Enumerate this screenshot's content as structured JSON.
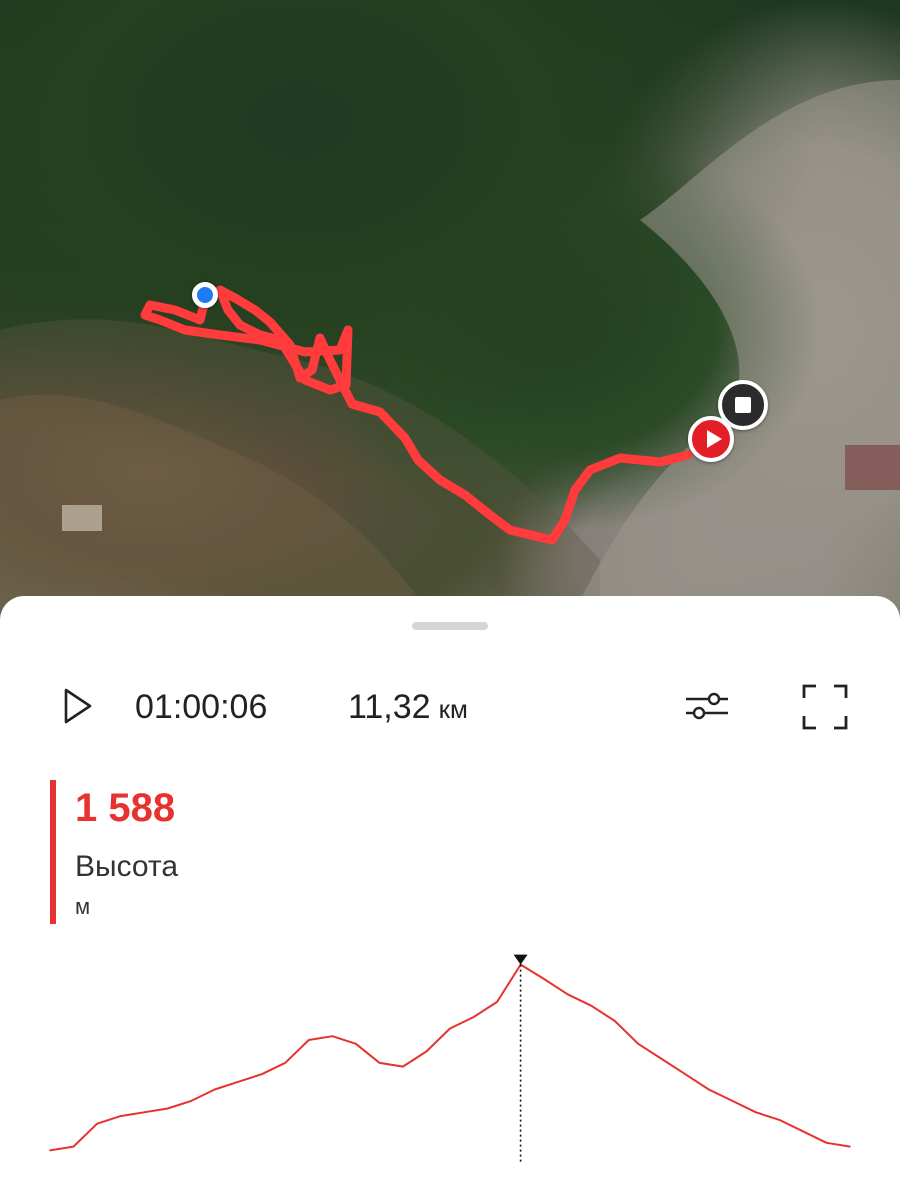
{
  "map": {
    "markers": [
      "current-location",
      "track-start",
      "track-end"
    ],
    "route_color": "#ff3b3b"
  },
  "playback": {
    "time": "01:00:06",
    "distance_value": "11,32",
    "distance_unit": "км"
  },
  "metric": {
    "value": "1 588",
    "label": "Высота",
    "unit": "м",
    "accent": "#e8322f"
  },
  "chart_data": {
    "type": "area",
    "series": [
      {
        "values": [
          1100,
          1110,
          1170,
          1190,
          1200,
          1210,
          1230,
          1260,
          1280,
          1300,
          1330,
          1390,
          1400,
          1380,
          1330,
          1320,
          1360,
          1420,
          1450,
          1490,
          1588,
          1550,
          1510,
          1480,
          1440,
          1380,
          1340,
          1300,
          1260,
          1230,
          1200,
          1180,
          1150,
          1120,
          1110
        ],
        "color": "#e8322f"
      }
    ],
    "marker_index": 20,
    "ylim": [
      1080,
      1600
    ],
    "grid": false
  },
  "icons": {
    "play": "play-icon",
    "settings": "sliders-icon",
    "fullscreen": "fullscreen-icon"
  }
}
